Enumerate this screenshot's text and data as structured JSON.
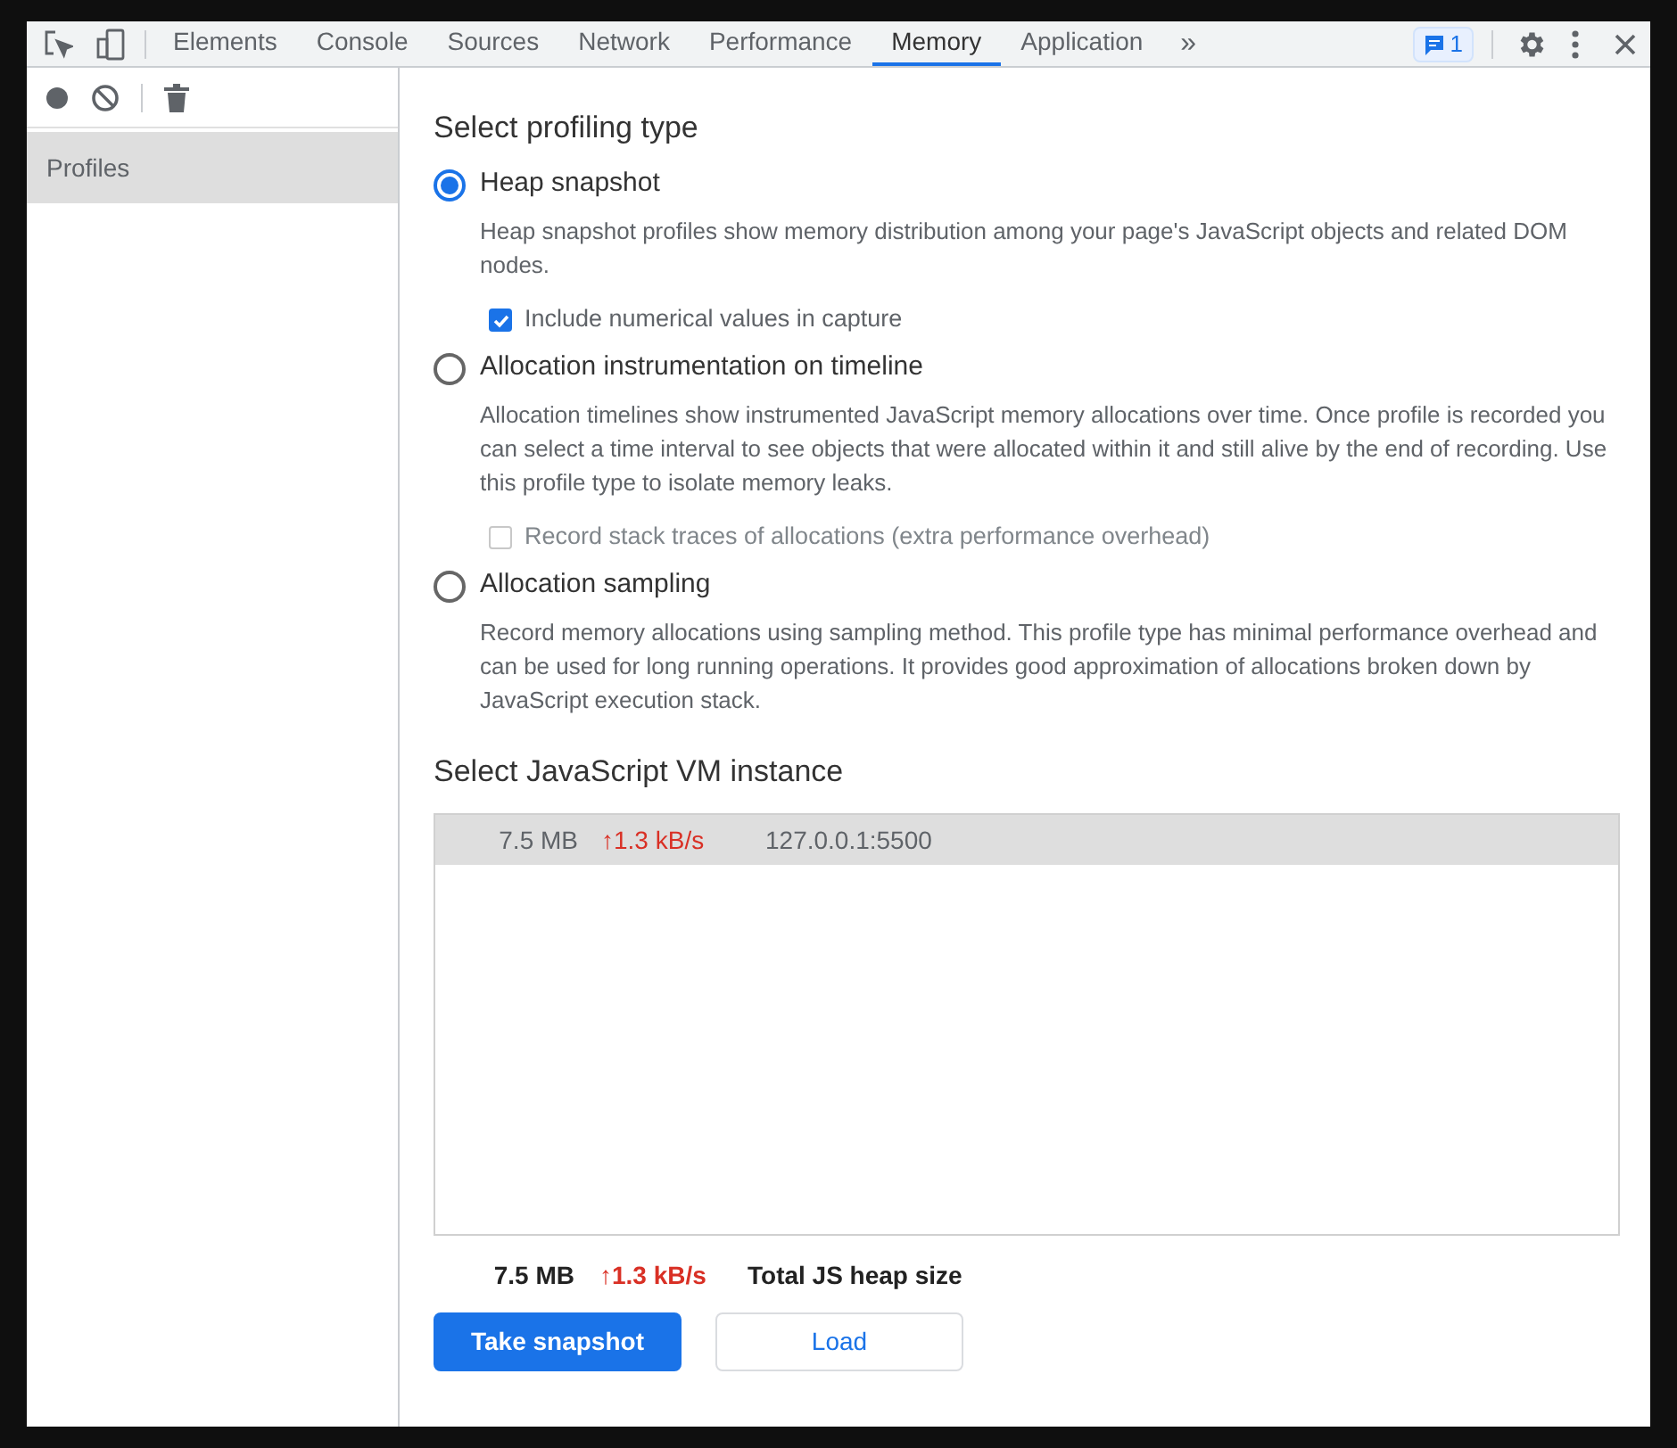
{
  "tabs": [
    {
      "label": "Elements",
      "selected": false
    },
    {
      "label": "Console",
      "selected": false
    },
    {
      "label": "Sources",
      "selected": false
    },
    {
      "label": "Network",
      "selected": false
    },
    {
      "label": "Performance",
      "selected": false
    },
    {
      "label": "Memory",
      "selected": true
    },
    {
      "label": "Application",
      "selected": false
    }
  ],
  "more_tabs": "»",
  "issues_badge": "1",
  "sidebar": {
    "items": [
      {
        "label": "Profiles",
        "selected": true
      }
    ]
  },
  "profiling": {
    "title": "Select profiling type",
    "options": [
      {
        "label": "Heap snapshot",
        "selected": true,
        "description": "Heap snapshot profiles show memory distribution among your page's JavaScript objects and related DOM nodes.",
        "checkbox": {
          "label": "Include numerical values in capture",
          "checked": true,
          "disabled": false
        }
      },
      {
        "label": "Allocation instrumentation on timeline",
        "selected": false,
        "description": "Allocation timelines show instrumented JavaScript memory allocations over time. Once profile is recorded you can select a time interval to see objects that were allocated within it and still alive by the end of recording. Use this profile type to isolate memory leaks.",
        "checkbox": {
          "label": "Record stack traces of allocations (extra performance overhead)",
          "checked": false,
          "disabled": true
        }
      },
      {
        "label": "Allocation sampling",
        "selected": false,
        "description": "Record memory allocations using sampling method. This profile type has minimal performance overhead and can be used for long running operations. It provides good approximation of allocations broken down by JavaScript execution stack."
      }
    ]
  },
  "vm": {
    "title": "Select JavaScript VM instance",
    "rows": [
      {
        "size": "7.5 MB",
        "rate": "↑1.3 kB/s",
        "target": "127.0.0.1:5500",
        "selected": true
      }
    ],
    "total": {
      "size": "7.5 MB",
      "rate": "↑1.3 kB/s",
      "label": "Total JS heap size"
    }
  },
  "buttons": [
    {
      "label": "Take snapshot",
      "kind": "primary"
    },
    {
      "label": "Load",
      "kind": "secondary"
    }
  ]
}
